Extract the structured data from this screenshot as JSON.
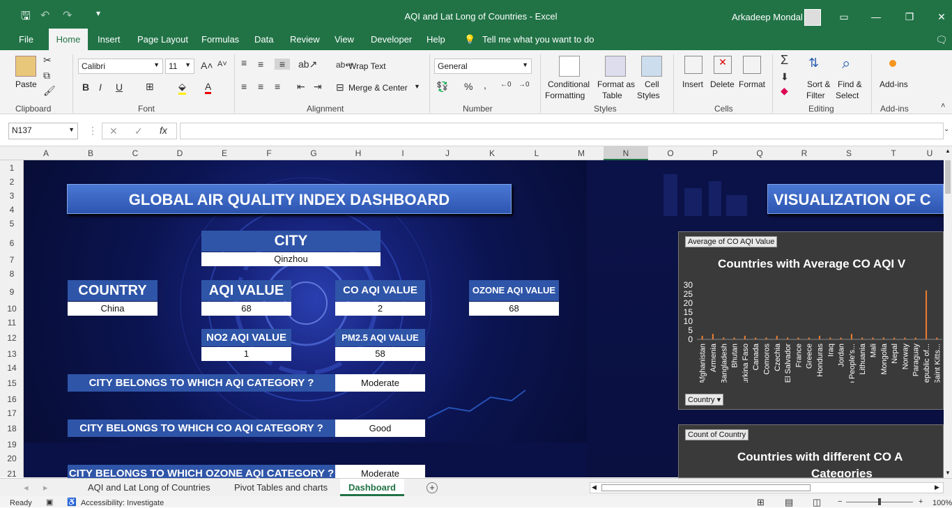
{
  "window": {
    "title": "AQI and Lat Long of Countries  -  Excel",
    "user": "Arkadeep Mondal"
  },
  "ribbon_tabs": [
    "File",
    "Home",
    "Insert",
    "Page Layout",
    "Formulas",
    "Data",
    "Review",
    "View",
    "Developer",
    "Help"
  ],
  "tell_me": "Tell me what you want to do",
  "ribbon": {
    "paste": "Paste",
    "clipboard": "Clipboard",
    "font_name": "Calibri",
    "font_size": "11",
    "font": "Font",
    "wrap_text": "Wrap Text",
    "merge_center": "Merge & Center",
    "alignment": "Alignment",
    "number_format": "General",
    "number": "Number",
    "conditional": "Conditional",
    "formatting": "Formatting",
    "format_as": "Format as",
    "table": "Table",
    "cell": "Cell",
    "styles_lbl": "Styles",
    "styles": "Styles",
    "insert": "Insert",
    "delete": "Delete",
    "format": "Format",
    "cells": "Cells",
    "sort": "Sort &",
    "filter": "Filter",
    "find": "Find &",
    "select": "Select",
    "editing": "Editing",
    "addins": "Add-ins",
    "addins_group": "Add-ins"
  },
  "formula_bar": {
    "name_box": "N137",
    "formula": ""
  },
  "columns": [
    "A",
    "B",
    "C",
    "D",
    "E",
    "F",
    "G",
    "H",
    "I",
    "J",
    "K",
    "L",
    "M",
    "N",
    "O",
    "P",
    "Q",
    "R",
    "S",
    "T",
    "U"
  ],
  "rows": [
    "1",
    "2",
    "3",
    "4",
    "5",
    "6",
    "7",
    "8",
    "9",
    "10",
    "11",
    "12",
    "13",
    "14",
    "15",
    "16",
    "17",
    "18",
    "19",
    "20",
    "21"
  ],
  "dashboard": {
    "title": "GLOBAL AIR QUALITY INDEX DASHBOARD",
    "city_label": "CITY",
    "city": "Qinzhou",
    "country_label": "COUNTRY",
    "country": "China",
    "aqi_label": "AQI VALUE",
    "aqi": "68",
    "co_label": "CO AQI VALUE",
    "co": "2",
    "ozone_label": "OZONE AQI VALUE",
    "ozone": "68",
    "no2_label": "NO2 AQI VALUE",
    "no2": "1",
    "pm25_label": "PM2.5 AQI VALUE",
    "pm25": "58",
    "q_aqi": "CITY BELONGS TO WHICH AQI CATEGORY ?",
    "a_aqi": "Moderate",
    "q_co": "CITY BELONGS TO WHICH CO AQI CATEGORY ?",
    "a_co": "Good",
    "q_ozone": "CITY BELONGS TO WHICH OZONE AQI CATEGORY ?",
    "a_ozone": "Moderate"
  },
  "right": {
    "title": "VISUALIZATION OF C",
    "chart1_field": "Average of CO AQI Value",
    "chart1_title": "Countries with Average CO AQI V",
    "chart1_filter": "Country",
    "chart2_field": "Count of Country",
    "chart2_title_1": "Countries with different CO A",
    "chart2_title_2": "Categories"
  },
  "chart_data": {
    "type": "bar",
    "title": "Countries with Average CO AQI V",
    "ylim": [
      0,
      30
    ],
    "yticks": [
      "30",
      "25",
      "20",
      "15",
      "10",
      "5",
      "0"
    ],
    "categories": [
      "Afghanistan",
      "Armenia",
      "Bangladesh",
      "Bhutan",
      "Burkina Faso",
      "Canada",
      "Comoros",
      "Czechia",
      "El Salvador",
      "France",
      "Greece",
      "Honduras",
      "Iraq",
      "Jordan",
      "Lao People's...",
      "Lithuania",
      "Mali",
      "Mongolia",
      "Nepal",
      "Norway",
      "Paraguay",
      "Republic of...",
      "Saint Kitts..."
    ],
    "values": [
      2,
      3,
      1,
      1,
      2,
      1,
      1,
      2,
      1,
      1,
      1,
      2,
      1,
      1,
      3,
      1,
      1,
      1,
      1,
      1,
      1,
      27,
      1
    ],
    "color": "#ed7d31"
  },
  "sheet_tabs": [
    "AQI and Lat Long of Countries",
    "Pivot Tables and charts",
    "Dashboard"
  ],
  "status": {
    "ready": "Ready",
    "accessibility": "Accessibility: Investigate",
    "zoom": "100%"
  }
}
